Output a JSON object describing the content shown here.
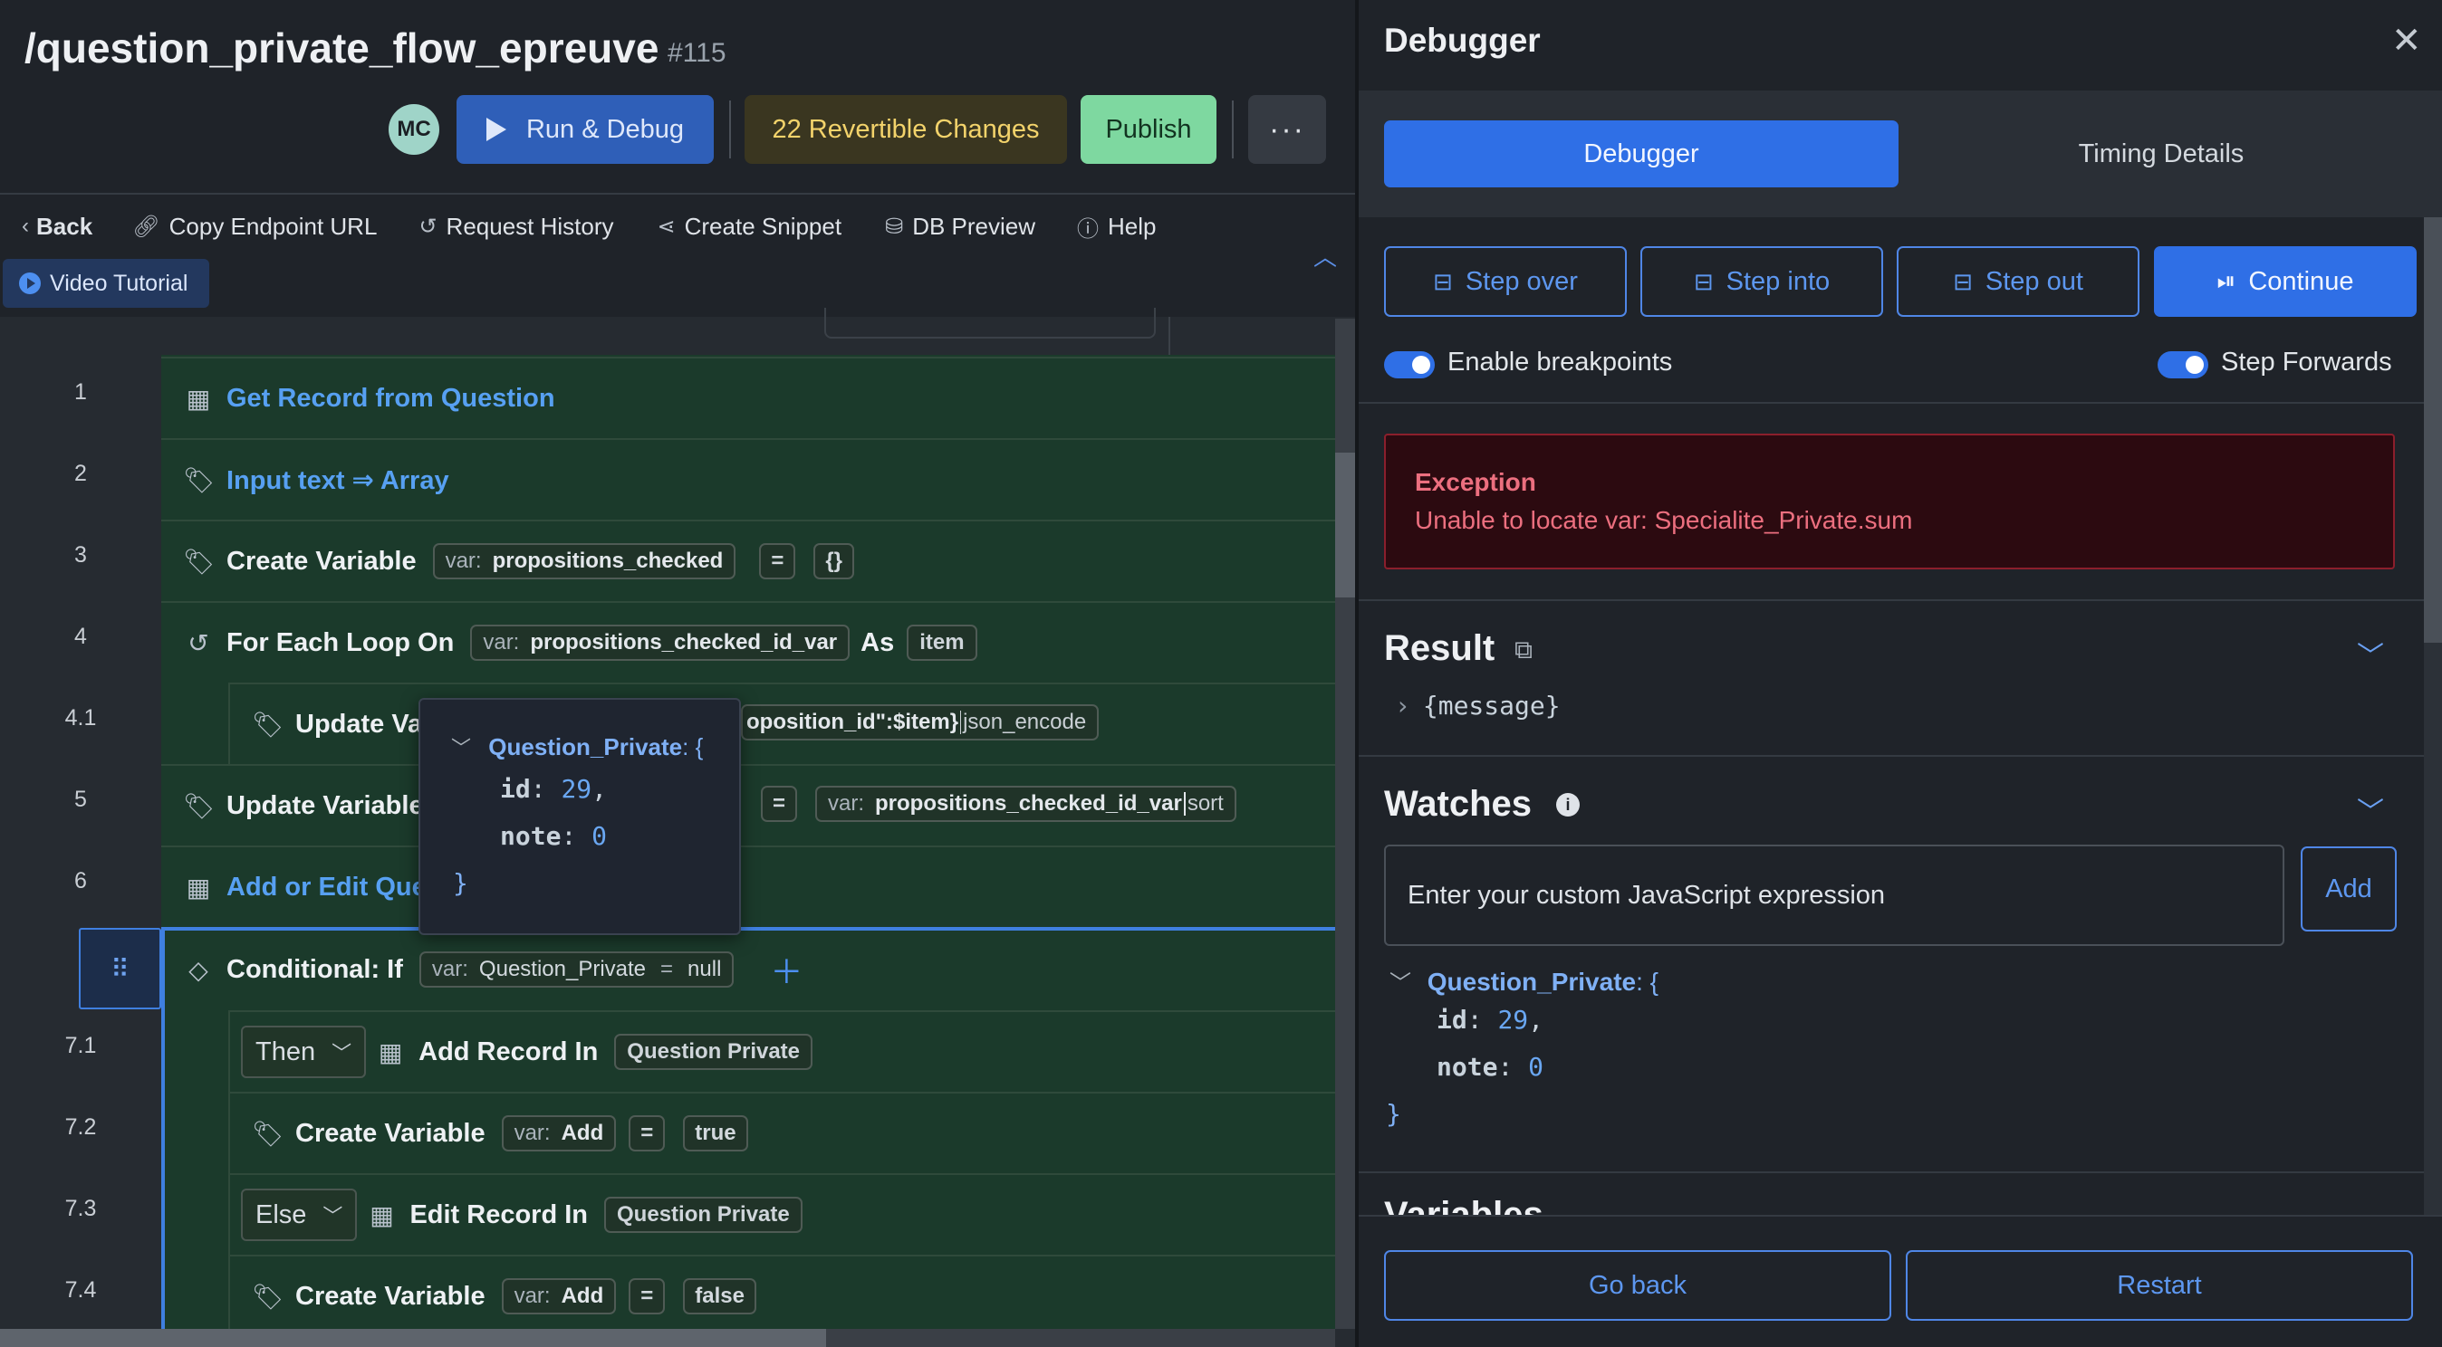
{
  "header": {
    "title": "/question_private_flow_epreuve",
    "id": "#115",
    "avatar_initials": "MC",
    "run_label": "Run & Debug",
    "revertible_label": "22 Revertible Changes",
    "publish_label": "Publish",
    "more_label": "···"
  },
  "toolbar": {
    "back": "Back",
    "copy_endpoint": "Copy Endpoint URL",
    "request_history": "Request History",
    "create_snippet": "Create Snippet",
    "db_preview": "DB Preview",
    "help": "Help",
    "video_tutorial": "Video Tutorial"
  },
  "lines": [
    "1",
    "2",
    "3",
    "4",
    "4.1",
    "5",
    "6",
    "7.1",
    "7.2",
    "7.3",
    "7.4"
  ],
  "rows": {
    "r1": {
      "label": "Get Record from Question"
    },
    "r2": {
      "label": "Input text ⇒ Array"
    },
    "r3": {
      "label": "Create Variable",
      "var_key": "var:",
      "var_name": "propositions_checked",
      "op": "=",
      "value": "{}"
    },
    "r4": {
      "label": "For Each Loop On",
      "var_key": "var:",
      "var_name": "propositions_checked_id_var",
      "as": "As",
      "item": "item"
    },
    "r41": {
      "label": "Update Va",
      "chip_text": "oposition_id\":$item}",
      "filter": "json_encode"
    },
    "r5": {
      "label": "Update Variable",
      "op": "=",
      "var_key": "var:",
      "var_name": "propositions_checked_id_var",
      "filter": "sort"
    },
    "r6": {
      "label": "Add or Edit Que"
    },
    "r7": {
      "label": "Conditional: If",
      "var_key": "var:",
      "var_name": "Question_Private",
      "op": "=",
      "value": "null"
    },
    "r71": {
      "branch": "Then",
      "label": "Add Record In",
      "table": "Question Private"
    },
    "r72": {
      "label": "Create Variable",
      "var_key": "var:",
      "var_name": "Add",
      "op": "=",
      "value": "true"
    },
    "r73": {
      "branch": "Else",
      "label": "Edit Record In",
      "table": "Question Private"
    },
    "r74": {
      "label": "Create Variable",
      "var_key": "var:",
      "var_name": "Add",
      "op": "=",
      "value": "false"
    }
  },
  "popup": {
    "object_name": "Question_Private",
    "open": "{",
    "close": "}",
    "k1": "id",
    "v1": "29",
    "k2": "note",
    "v2": "0"
  },
  "debugger": {
    "title": "Debugger",
    "tab_debugger": "Debugger",
    "tab_timing": "Timing Details",
    "step_over": "Step over",
    "step_into": "Step into",
    "step_out": "Step out",
    "continue": "Continue",
    "enable_breakpoints": "Enable breakpoints",
    "step_forwards": "Step Forwards",
    "exception_title": "Exception",
    "exception_message": "Unable to locate var: Specialite_Private.sum",
    "result_title": "Result",
    "result_value": "{message}",
    "watches_title": "Watches",
    "watch_placeholder": "Enter your custom JavaScript expression",
    "add_label": "Add",
    "watch_object_name": "Question_Private",
    "watch_k1": "id",
    "watch_v1": "29",
    "watch_k2": "note",
    "watch_v2": "0",
    "variables_title": "Variables",
    "go_back": "Go back",
    "restart": "Restart"
  },
  "colors": {
    "accent": "#2f6fe6",
    "row_bg": "#1b3a2b",
    "exception_bg": "#2c0a10",
    "exception_text": "#ec6f7f",
    "publish_bg": "#7ed8a0",
    "revertible_text": "#f3d36b"
  },
  "icons": {
    "table": "table-icon",
    "tag": "tag-icon",
    "loop": "loop-icon",
    "diamond": "diamond-icon"
  }
}
